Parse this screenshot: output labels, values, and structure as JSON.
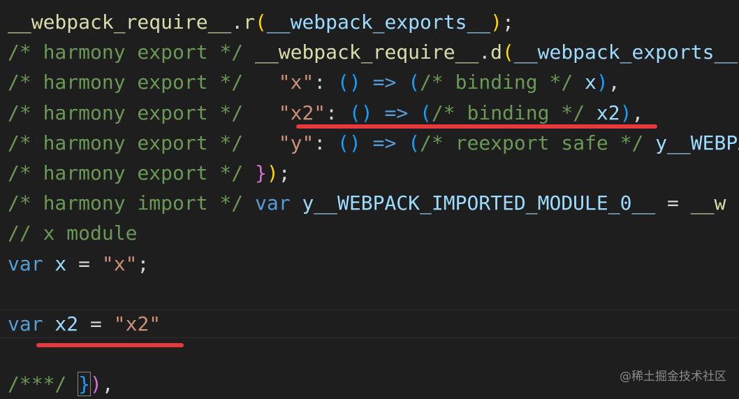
{
  "colors": {
    "background": "#1e1e1e",
    "comment": "#6a9955",
    "function": "#dcdcaa",
    "variable": "#9cdcfe",
    "string": "#ce9178",
    "keyword": "#569cd6",
    "bracket_level1": "#ffd700",
    "bracket_level2": "#da70d6",
    "bracket_level3": "#179fff",
    "annotation_underline": "#e5393d"
  },
  "code_lines": [
    [
      {
        "t": "__webpack_require__",
        "c": "fn"
      },
      {
        "t": ".",
        "c": "plain"
      },
      {
        "t": "r",
        "c": "fn"
      },
      {
        "t": "(",
        "c": "b1"
      },
      {
        "t": "__webpack_exports__",
        "c": "var"
      },
      {
        "t": ")",
        "c": "b1"
      },
      {
        "t": ";",
        "c": "plain"
      }
    ],
    [
      {
        "t": "/* harmony export */ ",
        "c": "comment"
      },
      {
        "t": "__webpack_require__",
        "c": "fn"
      },
      {
        "t": ".",
        "c": "plain"
      },
      {
        "t": "d",
        "c": "fn"
      },
      {
        "t": "(",
        "c": "b1"
      },
      {
        "t": "__webpack_exports__",
        "c": "var"
      }
    ],
    [
      {
        "t": "/* harmony export */   ",
        "c": "comment"
      },
      {
        "t": "\"x\"",
        "c": "str"
      },
      {
        "t": ": ",
        "c": "plain"
      },
      {
        "t": "()",
        "c": "b3"
      },
      {
        "t": " => ",
        "c": "kw"
      },
      {
        "t": "(",
        "c": "b3"
      },
      {
        "t": "/* binding */",
        "c": "comment"
      },
      {
        "t": " x",
        "c": "var"
      },
      {
        "t": ")",
        "c": "b3"
      },
      {
        "t": ",",
        "c": "plain"
      }
    ],
    [
      {
        "t": "/* harmony export */   ",
        "c": "comment"
      },
      {
        "t": "\"x2\"",
        "c": "str"
      },
      {
        "t": ": ",
        "c": "plain"
      },
      {
        "t": "()",
        "c": "b3"
      },
      {
        "t": " => ",
        "c": "kw"
      },
      {
        "t": "(",
        "c": "b3"
      },
      {
        "t": "/* binding */",
        "c": "comment"
      },
      {
        "t": " x2",
        "c": "var"
      },
      {
        "t": ")",
        "c": "b3"
      },
      {
        "t": ",",
        "c": "plain"
      }
    ],
    [
      {
        "t": "/* harmony export */   ",
        "c": "comment"
      },
      {
        "t": "\"y\"",
        "c": "str"
      },
      {
        "t": ": ",
        "c": "plain"
      },
      {
        "t": "()",
        "c": "b3"
      },
      {
        "t": " => ",
        "c": "kw"
      },
      {
        "t": "(",
        "c": "b3"
      },
      {
        "t": "/* reexport safe */",
        "c": "comment"
      },
      {
        "t": " y__WEBPACK",
        "c": "var"
      }
    ],
    [
      {
        "t": "/* harmony export */ ",
        "c": "comment"
      },
      {
        "t": "}",
        "c": "b2"
      },
      {
        "t": ")",
        "c": "b1"
      },
      {
        "t": ";",
        "c": "plain"
      }
    ],
    [
      {
        "t": "/* harmony import */ ",
        "c": "comment"
      },
      {
        "t": "var",
        "c": "kw"
      },
      {
        "t": " y__WEBPACK_IMPORTED_MODULE_0__",
        "c": "var"
      },
      {
        "t": " = ",
        "c": "plain"
      },
      {
        "t": "__w",
        "c": "fn"
      }
    ],
    [
      {
        "t": "// x module",
        "c": "comment"
      }
    ],
    [
      {
        "t": "var",
        "c": "kw"
      },
      {
        "t": " x",
        "c": "var"
      },
      {
        "t": " = ",
        "c": "plain"
      },
      {
        "t": "\"x\"",
        "c": "str"
      },
      {
        "t": ";",
        "c": "plain"
      }
    ],
    [],
    [
      {
        "t": "var",
        "c": "kw"
      },
      {
        "t": " x2",
        "c": "var"
      },
      {
        "t": " = ",
        "c": "plain"
      },
      {
        "t": "\"x2\"",
        "c": "str"
      }
    ],
    [],
    [
      {
        "t": "/***/ ",
        "c": "comment"
      },
      {
        "t": "}",
        "c": "b3",
        "box": true
      },
      {
        "t": ")",
        "c": "b2"
      },
      {
        "t": ",",
        "c": "plain"
      }
    ]
  ],
  "watermark": "@稀土掘金技术社区"
}
